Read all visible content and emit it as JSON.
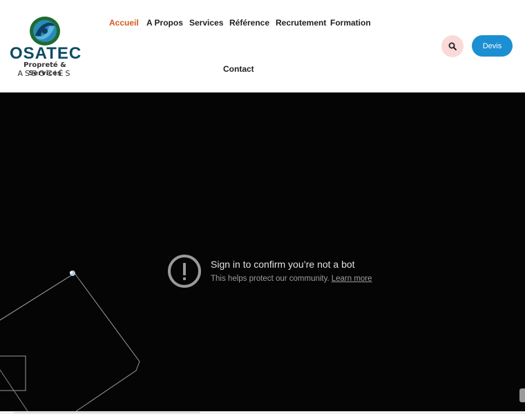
{
  "brand": {
    "name": "OSATEC",
    "tagline": "Propreté & Services",
    "tagline2": "ASSOCIÉS"
  },
  "nav": {
    "items": [
      {
        "label": "Accueil",
        "active": true
      },
      {
        "label": "A Propos",
        "active": false
      },
      {
        "label": "Services",
        "active": false
      },
      {
        "label": "Référence",
        "active": false
      },
      {
        "label": "Recrutement",
        "active": false
      },
      {
        "label": "Formation",
        "active": false
      },
      {
        "label": "Contact",
        "active": false
      }
    ],
    "search_icon": "search-icon",
    "cta_label": "Devis"
  },
  "video": {
    "title": "Sign in to confirm you’re not a bot",
    "message": "This helps protect our community.",
    "link": "Learn more",
    "icon": "alert-circle-icon"
  },
  "colors": {
    "accent": "#d55a1f",
    "cta": "#1b8fd2",
    "search_bg": "#fbd9d9",
    "logo": "#0d4b63"
  }
}
